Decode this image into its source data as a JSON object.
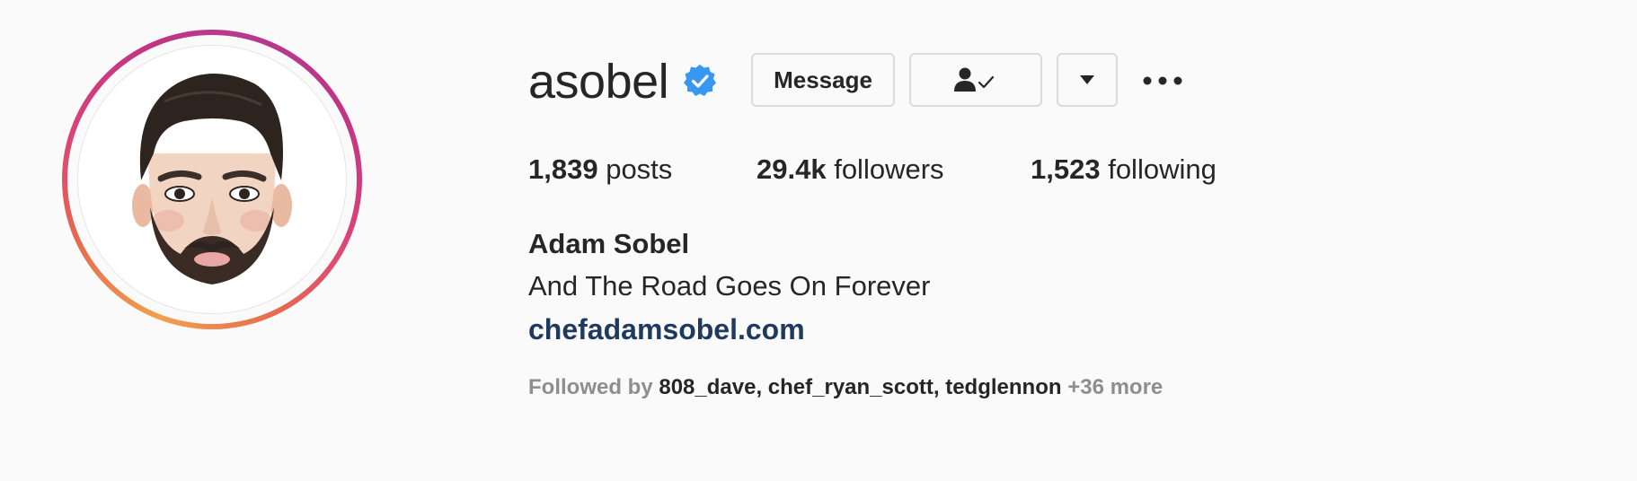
{
  "profile": {
    "username": "asobel",
    "verified_icon": "verified-badge-icon",
    "full_name": "Adam Sobel",
    "bio": "And The Road Goes On Forever",
    "website": "chefadamsobel.com"
  },
  "actions": {
    "message_label": "Message",
    "following_icon": "person-check-icon",
    "dropdown_icon": "caret-down-icon",
    "more_icon": "more-horizontal-icon"
  },
  "stats": {
    "posts_count": "1,839",
    "posts_label": "posts",
    "followers_count": "29.4k",
    "followers_label": "followers",
    "following_count": "1,523",
    "following_label": "following"
  },
  "followed_by": {
    "prefix": "Followed by",
    "names": [
      "808_dave",
      "chef_ryan_scott",
      "tedglennon"
    ],
    "separator": ",",
    "more": "+36 more"
  },
  "colors": {
    "verified": "#3897f0",
    "link": "#1e3a5f",
    "muted": "#8e8e8e",
    "text": "#262626"
  }
}
